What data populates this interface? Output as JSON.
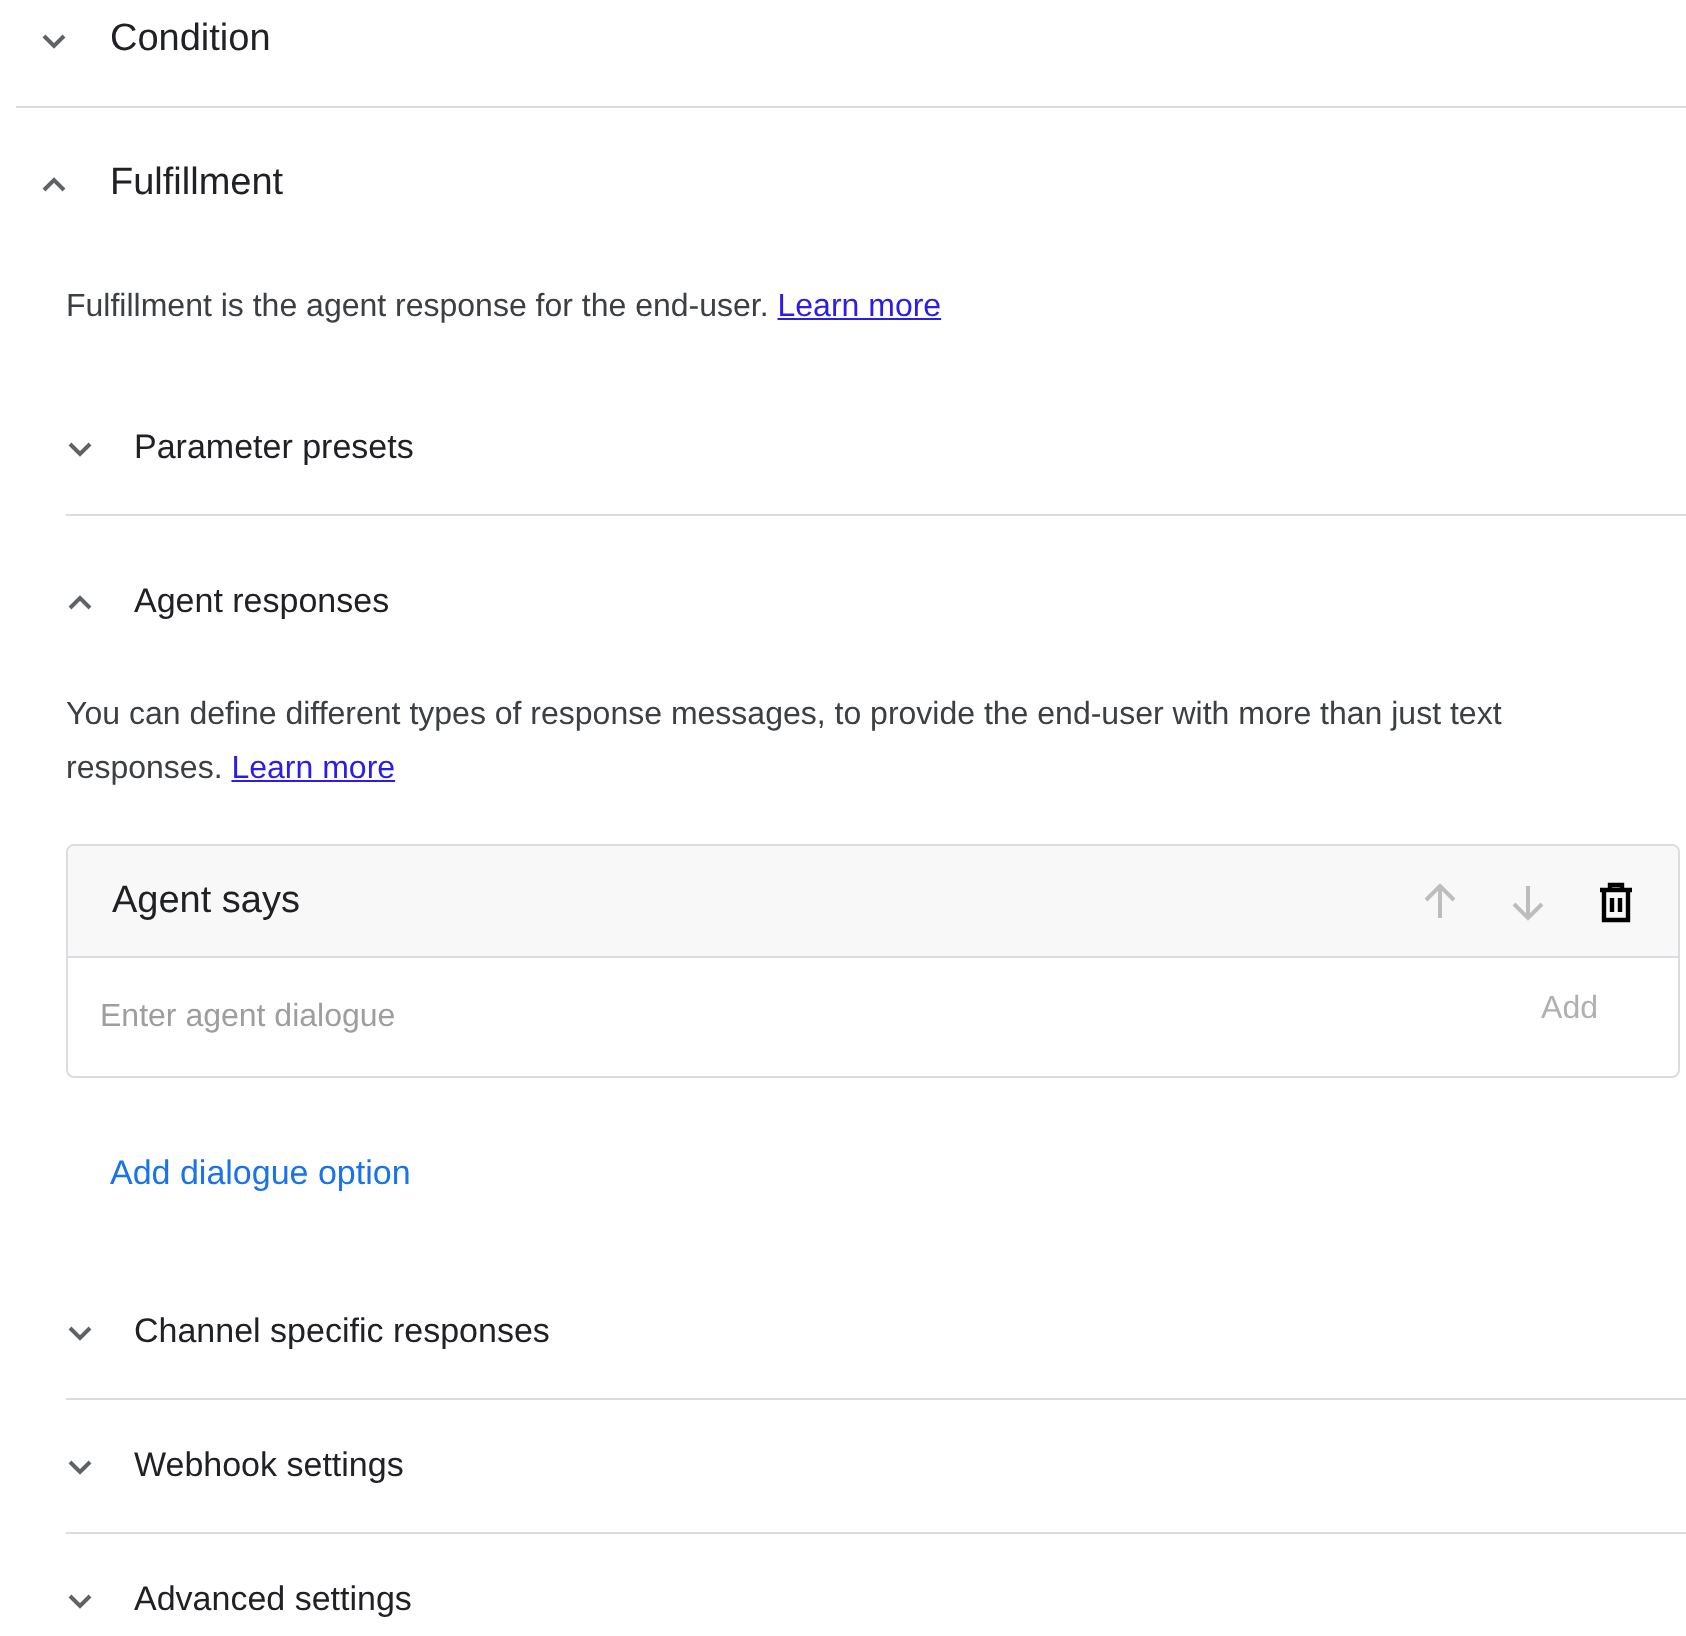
{
  "sections": [
    {
      "title": "Condition",
      "expanded": false
    },
    {
      "title": "Fulfillment",
      "expanded": true,
      "description": "Fulfillment is the agent response for the end-user.",
      "link": "Learn more",
      "subsections": [
        {
          "title": "Parameter presets",
          "expanded": false
        },
        {
          "title": "Agent responses",
          "expanded": true,
          "description": "You can define different types of response messages, to provide the end-user with more than just text responses.",
          "link": "Learn more",
          "card": {
            "title": "Agent says",
            "actions": [
              {
                "kind": "up",
                "disabled": true
              },
              {
                "kind": "down",
                "disabled": true
              },
              {
                "kind": "delete",
                "disabled": false
              }
            ],
            "input": {
              "placeholder": "Enter agent dialogue"
            },
            "add_button": {
              "label": "Add",
              "disabled": true
            }
          },
          "add_option": "Add dialogue option"
        },
        {
          "title": "Channel specific responses",
          "expanded": false
        },
        {
          "title": "Webhook settings",
          "expanded": false
        },
        {
          "title": "Advanced settings",
          "expanded": false
        }
      ]
    }
  ]
}
